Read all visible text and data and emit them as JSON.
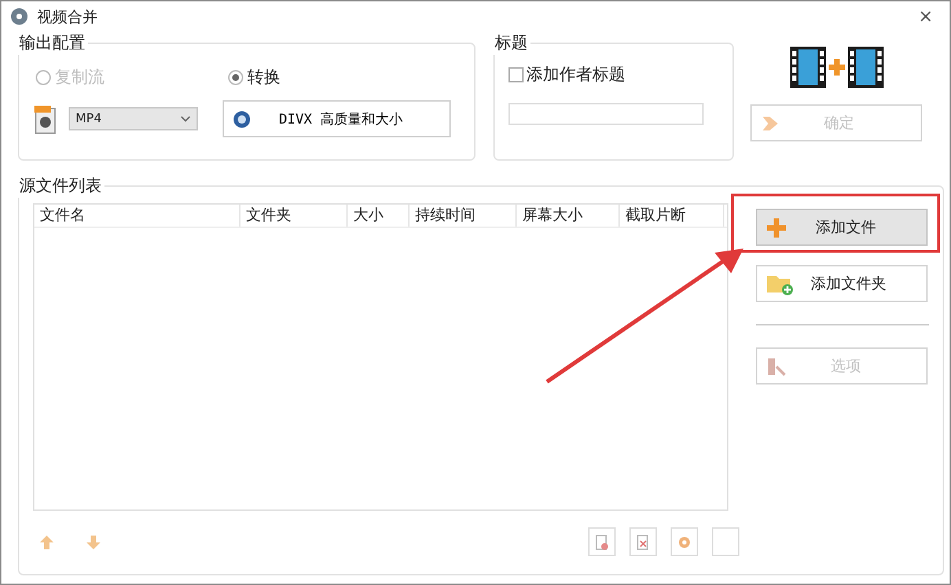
{
  "window": {
    "title": "视频合并",
    "close": "×"
  },
  "output_config": {
    "title": "输出配置",
    "modes": [
      {
        "label": "复制流",
        "selected": false,
        "disabled": true
      },
      {
        "label": "转换",
        "selected": true,
        "disabled": false
      }
    ],
    "format": "MP4",
    "profile": "DIVX 高质量和大小"
  },
  "caption": {
    "title": "标题",
    "checkbox": {
      "label": "添加作者标题",
      "checked": false
    }
  },
  "ok_button": {
    "label": "确定",
    "disabled": true
  },
  "source_list": {
    "title": "源文件列表",
    "columns": [
      "文件名",
      "文件夹",
      "大小",
      "持续时间",
      "屏幕大小",
      "截取片断"
    ],
    "buttons": [
      {
        "label": "添加文件",
        "kind": "add-file",
        "disabled": false,
        "highlighted": true
      },
      {
        "label": "添加文件夹",
        "kind": "add-folder",
        "disabled": false,
        "highlighted": false
      },
      {
        "label": "选项",
        "kind": "options",
        "disabled": true,
        "highlighted": false
      }
    ]
  },
  "annotation": {
    "highlight": true,
    "arrow": true
  }
}
